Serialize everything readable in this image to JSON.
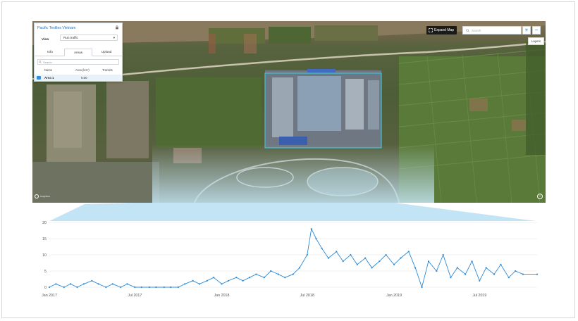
{
  "colors": {
    "accent": "#2a6fb4",
    "series": "#2b8ad8",
    "area_outline": "#3ec1d6",
    "projection": "#bfe3f4"
  },
  "panel": {
    "title": "Pacific Textiles Vietnam",
    "view_label": "View",
    "view_value": "Run traffic",
    "tabs": [
      {
        "label": "Info",
        "active": false
      },
      {
        "label": "Areas",
        "active": true
      },
      {
        "label": "Upload",
        "active": false
      }
    ],
    "search_placeholder": "Search",
    "columns": [
      "Name",
      "Area (km²)",
      "Transits"
    ],
    "rows": [
      {
        "name": "Area 1",
        "area": "0.00",
        "transits": ""
      }
    ]
  },
  "map_controls": {
    "expand_label": "Expand Map",
    "search_placeholder": "Search",
    "zoom_in": "+",
    "zoom_out": "−",
    "layers_label": "Layers",
    "brand": "mapbox",
    "info": "i"
  },
  "chart_data": {
    "type": "line",
    "title": "",
    "xlabel": "",
    "ylabel": "",
    "ylim": [
      0,
      20
    ],
    "yticks": [
      0,
      5,
      10,
      15,
      20
    ],
    "xticks": [
      "Jan 2017",
      "Jul 2017",
      "Jan 2018",
      "Jul 2018",
      "Jan 2019",
      "Jul 2019"
    ],
    "x_start": "2017-01-01",
    "x_end": "2019-10-31",
    "series": [
      {
        "name": "",
        "points": [
          [
            "2017-01-01",
            0
          ],
          [
            "2017-01-15",
            1
          ],
          [
            "2017-02-01",
            0
          ],
          [
            "2017-02-15",
            1
          ],
          [
            "2017-03-01",
            0
          ],
          [
            "2017-03-15",
            1
          ],
          [
            "2017-04-01",
            2
          ],
          [
            "2017-04-15",
            1
          ],
          [
            "2017-05-01",
            0
          ],
          [
            "2017-05-15",
            1
          ],
          [
            "2017-06-01",
            0
          ],
          [
            "2017-06-15",
            1
          ],
          [
            "2017-07-01",
            0
          ],
          [
            "2017-07-15",
            0
          ],
          [
            "2017-08-01",
            0
          ],
          [
            "2017-08-15",
            0
          ],
          [
            "2017-09-01",
            0
          ],
          [
            "2017-09-15",
            0
          ],
          [
            "2017-10-01",
            0
          ],
          [
            "2017-10-15",
            1
          ],
          [
            "2017-11-01",
            2
          ],
          [
            "2017-11-15",
            1
          ],
          [
            "2017-12-01",
            2
          ],
          [
            "2017-12-15",
            3
          ],
          [
            "2018-01-01",
            1
          ],
          [
            "2018-01-15",
            2
          ],
          [
            "2018-02-01",
            3
          ],
          [
            "2018-02-15",
            2
          ],
          [
            "2018-03-01",
            3
          ],
          [
            "2018-03-15",
            4
          ],
          [
            "2018-04-01",
            3
          ],
          [
            "2018-04-15",
            5
          ],
          [
            "2018-05-01",
            4
          ],
          [
            "2018-05-15",
            3
          ],
          [
            "2018-06-01",
            4
          ],
          [
            "2018-06-15",
            6
          ],
          [
            "2018-07-01",
            10
          ],
          [
            "2018-07-10",
            18
          ],
          [
            "2018-07-20",
            15
          ],
          [
            "2018-08-01",
            12
          ],
          [
            "2018-08-15",
            9
          ],
          [
            "2018-09-01",
            11
          ],
          [
            "2018-09-15",
            8
          ],
          [
            "2018-10-01",
            10
          ],
          [
            "2018-10-15",
            7
          ],
          [
            "2018-11-01",
            9
          ],
          [
            "2018-11-15",
            6
          ],
          [
            "2018-12-01",
            8
          ],
          [
            "2018-12-15",
            10
          ],
          [
            "2019-01-01",
            7
          ],
          [
            "2019-01-15",
            9
          ],
          [
            "2019-02-01",
            11
          ],
          [
            "2019-02-15",
            6
          ],
          [
            "2019-03-01",
            0
          ],
          [
            "2019-03-15",
            8
          ],
          [
            "2019-04-01",
            5
          ],
          [
            "2019-04-15",
            10
          ],
          [
            "2019-05-01",
            3
          ],
          [
            "2019-05-15",
            6
          ],
          [
            "2019-06-01",
            4
          ],
          [
            "2019-06-15",
            8
          ],
          [
            "2019-07-01",
            2
          ],
          [
            "2019-07-15",
            6
          ],
          [
            "2019-08-01",
            4
          ],
          [
            "2019-08-15",
            7
          ],
          [
            "2019-09-01",
            3
          ],
          [
            "2019-09-15",
            5
          ],
          [
            "2019-10-01",
            4
          ],
          [
            "2019-10-31",
            4
          ]
        ]
      }
    ]
  }
}
